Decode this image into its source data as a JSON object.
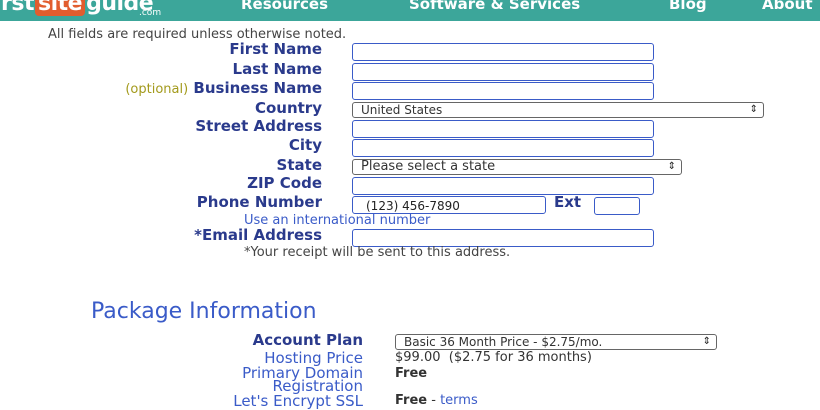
{
  "header": {
    "logo_left": "irst",
    "logo_mid": "site",
    "logo_right": "guide",
    "logo_sub": ".com",
    "nav": [
      "Resources",
      "Software & Services",
      "Blog",
      "About"
    ]
  },
  "form": {
    "notice": "All fields are required unless otherwise noted.",
    "first_name_label": "First Name",
    "last_name_label": "Last Name",
    "optional_tag": "(optional)",
    "business_name_label": "Business Name",
    "country_label": "Country",
    "country_value": "United States",
    "street_label": "Street Address",
    "city_label": "City",
    "state_label": "State",
    "state_value": "Please select a state",
    "zip_label": "ZIP Code",
    "phone_label": "Phone Number",
    "phone_placeholder": "(123) 456-7890",
    "ext_label": "Ext",
    "intl_link": "Use an international number",
    "email_label": "*Email Address",
    "receipt_note": "*Your receipt will be sent to this address."
  },
  "package": {
    "title": "Package Information",
    "account_plan_label": "Account Plan",
    "account_plan_value": "Basic 36 Month Price - $2.75/mo.",
    "hosting_price_label": "Hosting Price",
    "hosting_price_value": "$99.00",
    "hosting_price_note": "($2.75 for 36 months)",
    "primary_domain_label_1": "Primary Domain",
    "primary_domain_label_2": "Registration",
    "primary_domain_value": "Free",
    "ssl_label": "Let's Encrypt SSL",
    "ssl_value": "Free",
    "ssl_sep": " - ",
    "ssl_link": "terms"
  },
  "icons": {
    "select_arrow": "up-down-chevron-icon"
  }
}
